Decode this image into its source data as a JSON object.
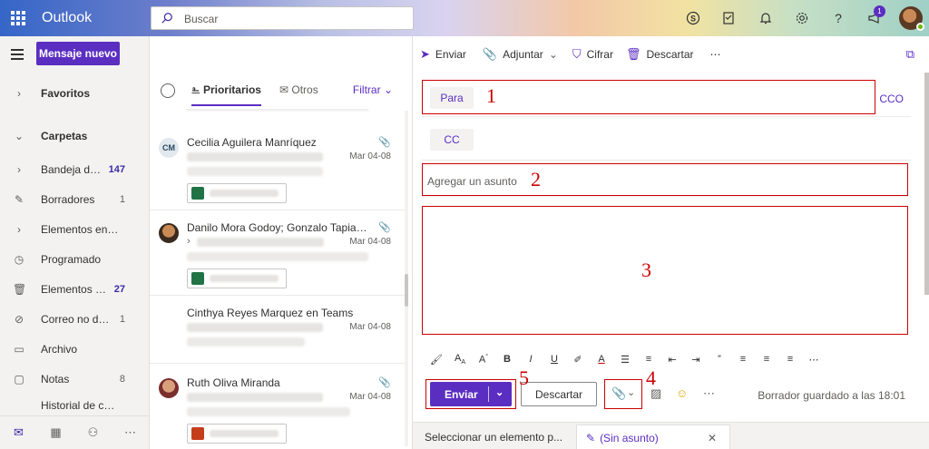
{
  "header": {
    "brand": "Outlook",
    "search_placeholder": "Buscar",
    "notif_count": "1",
    "icons": [
      "skype-icon",
      "todo-icon",
      "bell-icon",
      "gear-icon",
      "help-icon",
      "megaphone-icon",
      "avatar"
    ]
  },
  "nav": {
    "new_message": "Mensaje nuevo",
    "favorites": "Favoritos",
    "folders": "Carpetas",
    "items": [
      {
        "label": "Bandeja de...",
        "count": "147",
        "bold": true,
        "icon": "chevron-right-icon"
      },
      {
        "label": "Borradores",
        "count": "1",
        "bold": false,
        "icon": "pencil-icon"
      },
      {
        "label": "Elementos envi...",
        "count": "",
        "bold": false,
        "icon": "chevron-right-icon"
      },
      {
        "label": "Programado",
        "count": "",
        "bold": false,
        "icon": "clock-icon"
      },
      {
        "label": "Elementos e...",
        "count": "27",
        "bold": true,
        "icon": "trash-icon"
      },
      {
        "label": "Correo no des...",
        "count": "1",
        "bold": false,
        "icon": "block-icon"
      },
      {
        "label": "Archivo",
        "count": "",
        "bold": false,
        "icon": "archive-icon"
      },
      {
        "label": "Notas",
        "count": "8",
        "bold": false,
        "icon": "note-icon"
      },
      {
        "label": "Historial de con...",
        "count": "",
        "bold": false,
        "icon": ""
      }
    ]
  },
  "list": {
    "tab_focused": "Prioritarios",
    "tab_other": "Otros",
    "filter": "Filtrar",
    "messages": [
      {
        "initials": "CM",
        "sender": "Cecilia Aguilera Manríquez",
        "date": "Mar 04-08",
        "attach": true,
        "file_type": "excel"
      },
      {
        "initials": "",
        "sender": "Danilo Mora Godoy; Gonzalo Tapia He",
        "date": "Mar 04-08",
        "attach": true,
        "file_type": "excel"
      },
      {
        "initials": "",
        "sender": "Cinthya Reyes Marquez en Teams",
        "date": "Mar 04-08",
        "attach": false,
        "file_type": ""
      },
      {
        "initials": "",
        "sender": "Ruth Oliva Miranda",
        "date": "Mar 04-08",
        "attach": true,
        "file_type": "powerpoint"
      }
    ]
  },
  "compose": {
    "cmd_send": "Enviar",
    "cmd_attach": "Adjuntar",
    "cmd_encrypt": "Cifrar",
    "cmd_discard": "Descartar",
    "to": "Para",
    "cc": "CC",
    "bcc": "CCO",
    "subject_placeholder": "Agregar un asunto",
    "send": "Enviar",
    "discard": "Descartar",
    "saved_status": "Borrador guardado a las 18:01",
    "annotations": [
      "1",
      "2",
      "3",
      "4",
      "5"
    ]
  },
  "bottom_tabs": {
    "select_item": "Seleccionar un elemento p...",
    "draft": "(Sin asunto)"
  }
}
